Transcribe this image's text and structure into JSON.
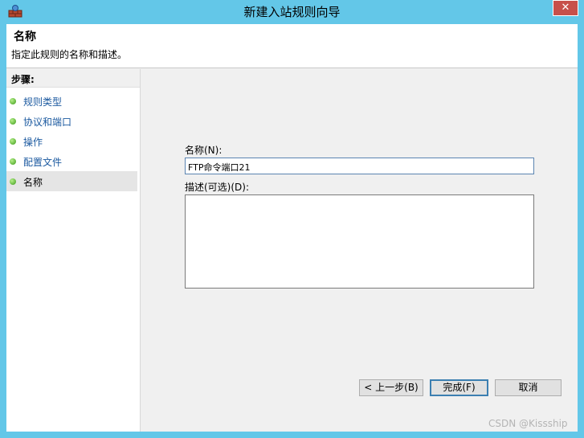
{
  "window": {
    "title": "新建入站规则向导",
    "close_label": "✕"
  },
  "header": {
    "title": "名称",
    "description": "指定此规则的名称和描述。"
  },
  "steps": {
    "title": "步骤:",
    "items": [
      {
        "label": "规则类型",
        "active": false
      },
      {
        "label": "协议和端口",
        "active": false
      },
      {
        "label": "操作",
        "active": false
      },
      {
        "label": "配置文件",
        "active": false
      },
      {
        "label": "名称",
        "active": true
      }
    ]
  },
  "form": {
    "name_label": "名称(N):",
    "name_value": "FTP命令端口21",
    "description_label": "描述(可选)(D):",
    "description_value": ""
  },
  "buttons": {
    "back": "< 上一步(B)",
    "finish": "完成(F)",
    "cancel": "取消"
  },
  "watermark": "CSDN @Kissship"
}
